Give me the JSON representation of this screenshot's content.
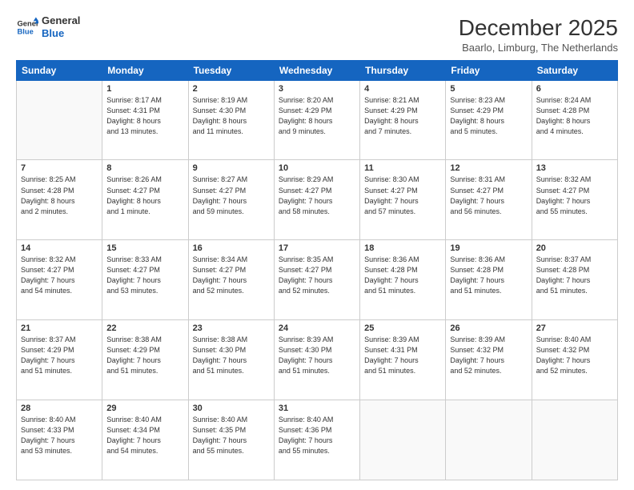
{
  "logo": {
    "line1": "General",
    "line2": "Blue"
  },
  "title": "December 2025",
  "subtitle": "Baarlo, Limburg, The Netherlands",
  "days_header": [
    "Sunday",
    "Monday",
    "Tuesday",
    "Wednesday",
    "Thursday",
    "Friday",
    "Saturday"
  ],
  "weeks": [
    [
      {
        "num": "",
        "info": ""
      },
      {
        "num": "1",
        "info": "Sunrise: 8:17 AM\nSunset: 4:31 PM\nDaylight: 8 hours\nand 13 minutes."
      },
      {
        "num": "2",
        "info": "Sunrise: 8:19 AM\nSunset: 4:30 PM\nDaylight: 8 hours\nand 11 minutes."
      },
      {
        "num": "3",
        "info": "Sunrise: 8:20 AM\nSunset: 4:29 PM\nDaylight: 8 hours\nand 9 minutes."
      },
      {
        "num": "4",
        "info": "Sunrise: 8:21 AM\nSunset: 4:29 PM\nDaylight: 8 hours\nand 7 minutes."
      },
      {
        "num": "5",
        "info": "Sunrise: 8:23 AM\nSunset: 4:29 PM\nDaylight: 8 hours\nand 5 minutes."
      },
      {
        "num": "6",
        "info": "Sunrise: 8:24 AM\nSunset: 4:28 PM\nDaylight: 8 hours\nand 4 minutes."
      }
    ],
    [
      {
        "num": "7",
        "info": "Sunrise: 8:25 AM\nSunset: 4:28 PM\nDaylight: 8 hours\nand 2 minutes."
      },
      {
        "num": "8",
        "info": "Sunrise: 8:26 AM\nSunset: 4:27 PM\nDaylight: 8 hours\nand 1 minute."
      },
      {
        "num": "9",
        "info": "Sunrise: 8:27 AM\nSunset: 4:27 PM\nDaylight: 7 hours\nand 59 minutes."
      },
      {
        "num": "10",
        "info": "Sunrise: 8:29 AM\nSunset: 4:27 PM\nDaylight: 7 hours\nand 58 minutes."
      },
      {
        "num": "11",
        "info": "Sunrise: 8:30 AM\nSunset: 4:27 PM\nDaylight: 7 hours\nand 57 minutes."
      },
      {
        "num": "12",
        "info": "Sunrise: 8:31 AM\nSunset: 4:27 PM\nDaylight: 7 hours\nand 56 minutes."
      },
      {
        "num": "13",
        "info": "Sunrise: 8:32 AM\nSunset: 4:27 PM\nDaylight: 7 hours\nand 55 minutes."
      }
    ],
    [
      {
        "num": "14",
        "info": "Sunrise: 8:32 AM\nSunset: 4:27 PM\nDaylight: 7 hours\nand 54 minutes."
      },
      {
        "num": "15",
        "info": "Sunrise: 8:33 AM\nSunset: 4:27 PM\nDaylight: 7 hours\nand 53 minutes."
      },
      {
        "num": "16",
        "info": "Sunrise: 8:34 AM\nSunset: 4:27 PM\nDaylight: 7 hours\nand 52 minutes."
      },
      {
        "num": "17",
        "info": "Sunrise: 8:35 AM\nSunset: 4:27 PM\nDaylight: 7 hours\nand 52 minutes."
      },
      {
        "num": "18",
        "info": "Sunrise: 8:36 AM\nSunset: 4:28 PM\nDaylight: 7 hours\nand 51 minutes."
      },
      {
        "num": "19",
        "info": "Sunrise: 8:36 AM\nSunset: 4:28 PM\nDaylight: 7 hours\nand 51 minutes."
      },
      {
        "num": "20",
        "info": "Sunrise: 8:37 AM\nSunset: 4:28 PM\nDaylight: 7 hours\nand 51 minutes."
      }
    ],
    [
      {
        "num": "21",
        "info": "Sunrise: 8:37 AM\nSunset: 4:29 PM\nDaylight: 7 hours\nand 51 minutes."
      },
      {
        "num": "22",
        "info": "Sunrise: 8:38 AM\nSunset: 4:29 PM\nDaylight: 7 hours\nand 51 minutes."
      },
      {
        "num": "23",
        "info": "Sunrise: 8:38 AM\nSunset: 4:30 PM\nDaylight: 7 hours\nand 51 minutes."
      },
      {
        "num": "24",
        "info": "Sunrise: 8:39 AM\nSunset: 4:30 PM\nDaylight: 7 hours\nand 51 minutes."
      },
      {
        "num": "25",
        "info": "Sunrise: 8:39 AM\nSunset: 4:31 PM\nDaylight: 7 hours\nand 51 minutes."
      },
      {
        "num": "26",
        "info": "Sunrise: 8:39 AM\nSunset: 4:32 PM\nDaylight: 7 hours\nand 52 minutes."
      },
      {
        "num": "27",
        "info": "Sunrise: 8:40 AM\nSunset: 4:32 PM\nDaylight: 7 hours\nand 52 minutes."
      }
    ],
    [
      {
        "num": "28",
        "info": "Sunrise: 8:40 AM\nSunset: 4:33 PM\nDaylight: 7 hours\nand 53 minutes."
      },
      {
        "num": "29",
        "info": "Sunrise: 8:40 AM\nSunset: 4:34 PM\nDaylight: 7 hours\nand 54 minutes."
      },
      {
        "num": "30",
        "info": "Sunrise: 8:40 AM\nSunset: 4:35 PM\nDaylight: 7 hours\nand 55 minutes."
      },
      {
        "num": "31",
        "info": "Sunrise: 8:40 AM\nSunset: 4:36 PM\nDaylight: 7 hours\nand 55 minutes."
      },
      {
        "num": "",
        "info": ""
      },
      {
        "num": "",
        "info": ""
      },
      {
        "num": "",
        "info": ""
      }
    ]
  ]
}
